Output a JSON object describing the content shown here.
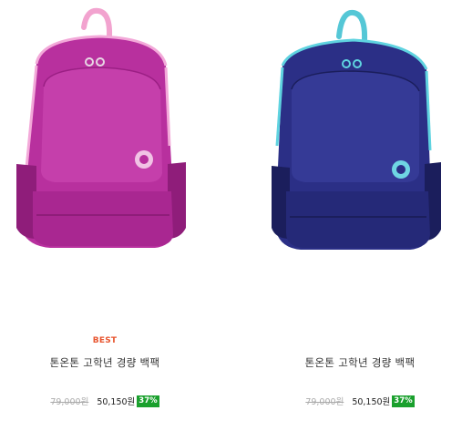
{
  "products": [
    {
      "badge": "BEST",
      "title": "톤온톤 고학년 경량 백팩",
      "original_price": "79,000원",
      "sale_price": "50,150원",
      "discount": "37%",
      "colors": {
        "body": "#b8309e",
        "body_dark": "#8f1d7a",
        "trim": "#f3a9d9",
        "handle": "#f2a3cf"
      }
    },
    {
      "badge": "",
      "title": "톤온톤 고학년 경량 백팩",
      "original_price": "79,000원",
      "sale_price": "50,150원",
      "discount": "37%",
      "colors": {
        "body": "#2b2f86",
        "body_dark": "#1b1e5c",
        "trim": "#5fd3e0",
        "handle": "#55c7d6"
      }
    }
  ],
  "accent": {
    "badge_color": "#e8552f",
    "discount_bg": "#1aa02d"
  }
}
